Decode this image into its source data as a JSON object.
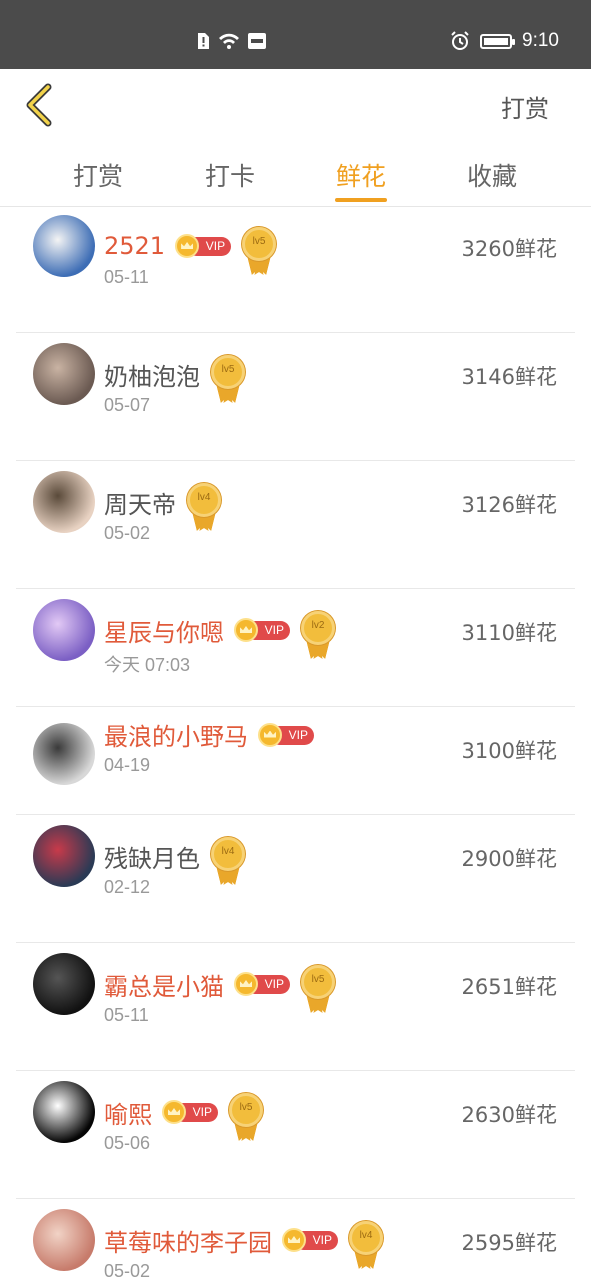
{
  "status_bar": {
    "time": "9:10",
    "icons": [
      "sim-alert-icon",
      "wifi-icon",
      "hms-icon",
      "alarm-icon",
      "battery-icon"
    ]
  },
  "header": {
    "back_icon": "chevron-left-icon",
    "action_label": "打赏"
  },
  "tabs": [
    {
      "label": "打赏",
      "active": false
    },
    {
      "label": "打卡",
      "active": false
    },
    {
      "label": "鲜花",
      "active": true
    },
    {
      "label": "收藏",
      "active": false
    }
  ],
  "colors": {
    "accent": "#f0a020",
    "vip_name": "#e05a3a",
    "vip_badge": "#e04a4a",
    "status_bar": "#4b4b4b"
  },
  "ranking": [
    {
      "name": "2521",
      "vip": true,
      "level": "lv5",
      "date": "05-11",
      "amount": "3260鲜花"
    },
    {
      "name": "奶柚泡泡",
      "vip": false,
      "level": "lv5",
      "date": "05-07",
      "amount": "3146鲜花"
    },
    {
      "name": "周天帝",
      "vip": false,
      "level": "lv4",
      "date": "05-02",
      "amount": "3126鲜花"
    },
    {
      "name": "星辰与你嗯",
      "vip": true,
      "level": "lv2",
      "date": "今天 07:03",
      "amount": "3110鲜花"
    },
    {
      "name": "最浪的小野马",
      "vip": true,
      "level": "",
      "date": "04-19",
      "amount": "3100鲜花"
    },
    {
      "name": "残缺月色",
      "vip": false,
      "level": "lv4",
      "date": "02-12",
      "amount": "2900鲜花"
    },
    {
      "name": "霸总是小猫",
      "vip": true,
      "level": "lv5",
      "date": "05-11",
      "amount": "2651鲜花"
    },
    {
      "name": "喻熙",
      "vip": true,
      "level": "lv5",
      "date": "05-06",
      "amount": "2630鲜花"
    },
    {
      "name": "草莓味的李子园",
      "vip": true,
      "level": "lv4",
      "date": "05-02",
      "amount": "2595鲜花"
    }
  ],
  "vip_label": "VIP"
}
